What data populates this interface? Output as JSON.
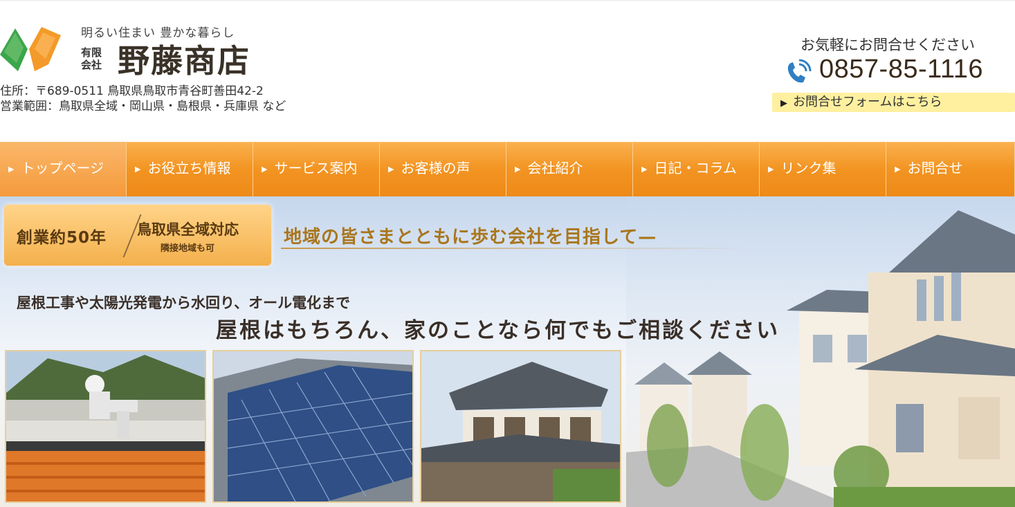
{
  "header": {
    "tagline": "明るい住まい 豊かな暮らし",
    "company_type": "有限会社",
    "company_name": "野藤商店",
    "address": "住所：〒689-0511 鳥取県鳥取市青谷町善田42-2",
    "service_area": "営業範囲：鳥取県全域・岡山県・島根県・兵庫県 など",
    "contact_lead": "お気軽にお問合せください",
    "phone": "0857-85-1116",
    "contact_form_link": "お問合せフォームはこちら"
  },
  "nav": {
    "items": [
      {
        "label": "トップページ",
        "active": true
      },
      {
        "label": "お役立ち情報",
        "active": false
      },
      {
        "label": "サービス案内",
        "active": false
      },
      {
        "label": "お客様の声",
        "active": false
      },
      {
        "label": "会社紹介",
        "active": false
      },
      {
        "label": "日記・コラム",
        "active": false
      },
      {
        "label": "リンク集",
        "active": false
      },
      {
        "label": "お問合せ",
        "active": false
      }
    ]
  },
  "hero": {
    "badge_years": "創業約50年",
    "badge_area": "鳥取県全域対応",
    "badge_sub": "隣接地域も可",
    "slogan": "地域の皆さまとともに歩む会社を目指して—",
    "sub_headline": "屋根工事や太陽光発電から水回り、オール電化まで",
    "main_headline": "屋根はもちろん、家のことなら何でもご相談ください"
  },
  "colors": {
    "nav_orange": "#f29422",
    "badge_orange": "#f4b04c",
    "slogan_gold": "#a9761c",
    "link_yellow": "#fff0a0",
    "logo_green": "#3aa64a",
    "logo_orange": "#f39a2a"
  },
  "icons": {
    "phone": "phone-icon",
    "nav_bullet": "triangle-right-icon"
  }
}
